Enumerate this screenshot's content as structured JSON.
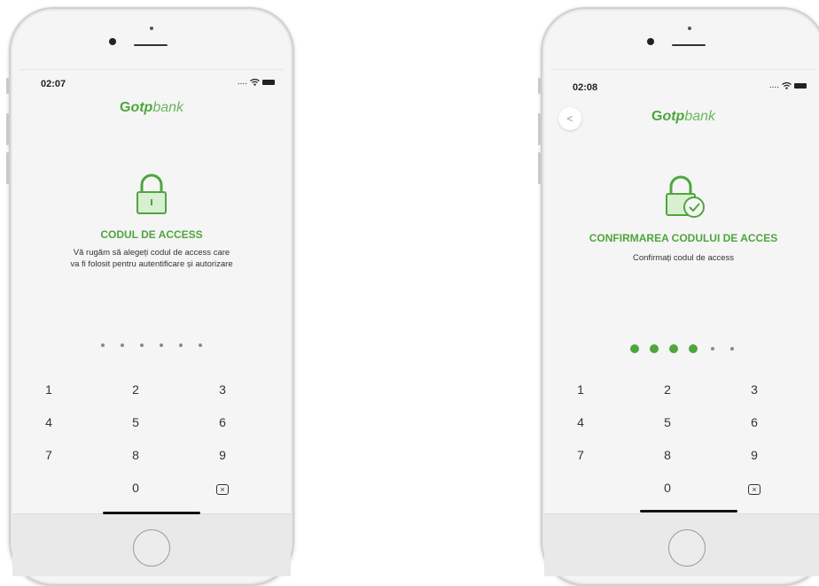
{
  "colors": {
    "brand_green": "#4ea63d",
    "dot_gray": "#8a8a8a"
  },
  "brand": {
    "mark": "G",
    "otp": "otp",
    "bank": "bank"
  },
  "screen1": {
    "time": "02:07",
    "status_signal": "....",
    "title": "CODUL DE ACCESS",
    "subtitle_line1": "Vă rugăm să alegeți codul de access care",
    "subtitle_line2": "va fi folosit pentru autentificare și autorizare",
    "lock_icon": "padlock-icon",
    "pin_filled": 0,
    "pin_total": 6,
    "keys": [
      "1",
      "2",
      "3",
      "4",
      "5",
      "6",
      "7",
      "8",
      "9",
      "",
      "0",
      "⌫"
    ]
  },
  "screen2": {
    "time": "02:08",
    "status_signal": "....",
    "back_label": "<",
    "title": "CONFIRMAREA CODULUI DE ACCES",
    "subtitle_line1": "Confirmați codul de access",
    "lock_icon": "padlock-check-icon",
    "pin_filled": 4,
    "pin_total": 6,
    "keys": [
      "1",
      "2",
      "3",
      "4",
      "5",
      "6",
      "7",
      "8",
      "9",
      "",
      "0",
      "⌫"
    ]
  }
}
